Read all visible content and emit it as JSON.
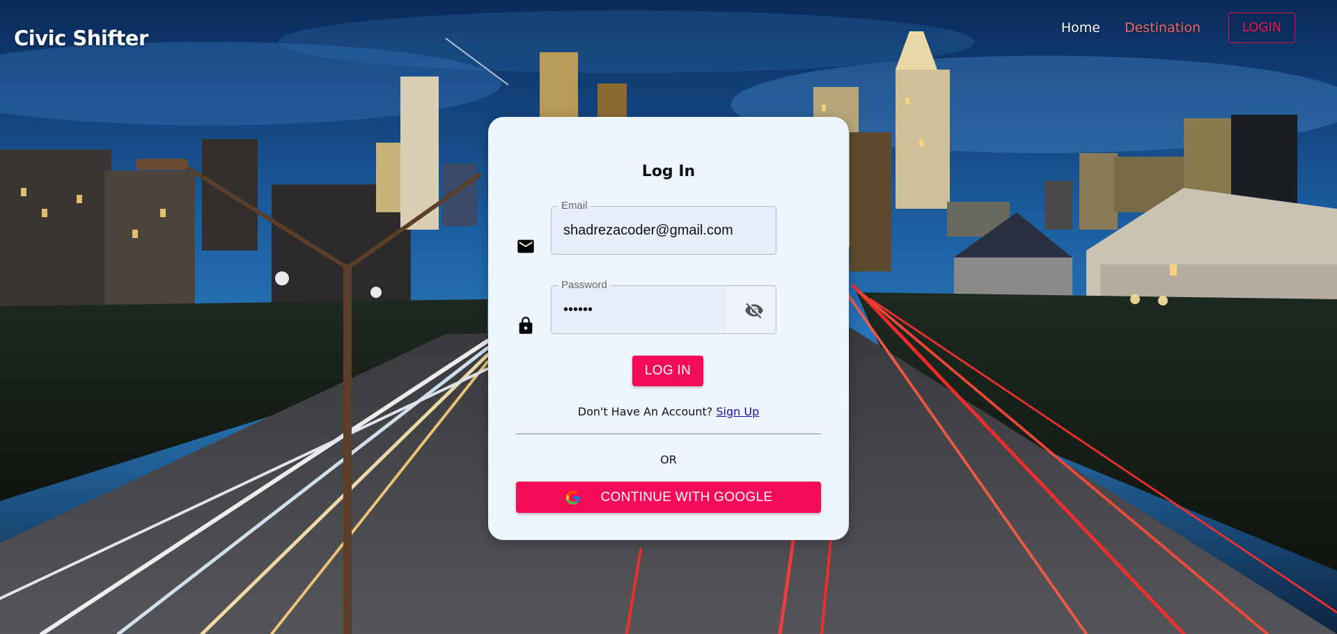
{
  "brand": {
    "name": "Civic Shifter"
  },
  "nav": {
    "home": "Home",
    "destination": "Destination",
    "login": "LOGIN"
  },
  "login_card": {
    "title": "Log In",
    "email": {
      "label": "Email",
      "value": "shadrezacoder@gmail.com"
    },
    "password": {
      "label": "Password",
      "value": "••••••"
    },
    "submit_label": "LOG IN",
    "no_account_text": "Don't Have An Account?",
    "signup_link": "Sign Up",
    "or_text": "OR",
    "google_label": "CONTINUE WITH GOOGLE"
  },
  "icons": {
    "email": "mail-icon",
    "password": "lock-icon",
    "toggle_password": "eye-off-icon",
    "google": "google-icon"
  },
  "colors": {
    "accent": "#f50a57",
    "card_bg": "#eff5fc",
    "nav_active": "#f06a6a"
  }
}
